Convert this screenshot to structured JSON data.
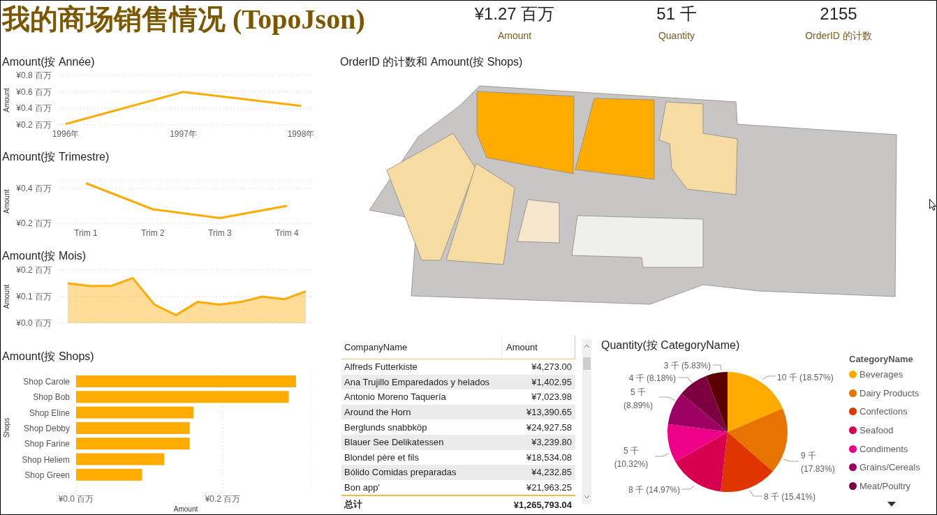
{
  "header": {
    "title": "我的商场销售情况 (TopoJson)",
    "kpis": [
      {
        "value": "¥1.27 百万",
        "label": "Amount"
      },
      {
        "value": "51 千",
        "label": "Quantity"
      },
      {
        "value": "2155",
        "label": "OrderID 的计数"
      }
    ]
  },
  "left_charts": [
    {
      "chart_data": {
        "type": "line",
        "title": "Amount(按 Année)",
        "ylabel": "Amount",
        "categories": [
          "1996年",
          "1997年",
          "1998年"
        ],
        "series": [
          {
            "color": "#ffab00",
            "values": [
              0.21,
              0.6,
              0.43
            ]
          }
        ],
        "ylim": [
          0.2,
          0.8
        ],
        "yticks": [
          {
            "value": 0.2,
            "label": "¥0.2 百万"
          },
          {
            "value": 0.4,
            "label": "¥0.4 百万"
          },
          {
            "value": 0.6,
            "label": "¥0.6 百万"
          },
          {
            "value": 0.8,
            "label": "¥0.8 百万"
          }
        ]
      }
    },
    {
      "chart_data": {
        "type": "line",
        "title": "Amount(按 Trimestre)",
        "ylabel": "Amount",
        "categories": [
          "Trim 1",
          "Trim 2",
          "Trim 3",
          "Trim 4"
        ],
        "series": [
          {
            "color": "#ffab00",
            "values": [
              0.43,
              0.28,
              0.23,
              0.3
            ]
          }
        ],
        "ylim": [
          0.2,
          0.45
        ],
        "yticks": [
          {
            "value": 0.2,
            "label": "¥0.2 百万"
          },
          {
            "value": 0.4,
            "label": "¥0.4 百万"
          }
        ]
      }
    },
    {
      "chart_data": {
        "type": "area",
        "title": "Amount(按 Mois)",
        "ylabel": "Amount",
        "series": [
          {
            "color": "#ffab00",
            "values": [
              0.15,
              0.14,
              0.14,
              0.17,
              0.07,
              0.03,
              0.08,
              0.07,
              0.08,
              0.1,
              0.09,
              0.12
            ]
          }
        ],
        "ylim": [
          0,
          0.2
        ],
        "yticks": [
          {
            "value": 0,
            "label": "¥0.0 百万"
          },
          {
            "value": 0.1,
            "label": "¥0.1 百万"
          },
          {
            "value": 0.2,
            "label": "¥0.2 百万"
          }
        ]
      }
    },
    {
      "chart_data": {
        "type": "bar",
        "orientation": "horizontal",
        "title": "Amount(按 Shops)",
        "xlabel": "Amount",
        "ylabel": "Shops",
        "categories": [
          "Shop Carole",
          "Shop Bob",
          "Shop Eline",
          "Shop Debby",
          "Shop Farine",
          "Shop Heliem",
          "Shop Green"
        ],
        "series": [
          {
            "color": "#ffab00",
            "values": [
              0.3,
              0.29,
              0.16,
              0.155,
              0.155,
              0.12,
              0.09
            ]
          }
        ],
        "xlim": [
          0,
          0.32
        ],
        "xticks": [
          {
            "value": 0,
            "label": "¥0.0 百万"
          },
          {
            "value": 0.2,
            "label": "¥0.2 百万"
          }
        ]
      }
    }
  ],
  "map": {
    "title": "OrderID 的计数和 Amount(按 Shops)"
  },
  "table": {
    "columns": [
      "CompanyName",
      "Amount"
    ],
    "rows": [
      [
        "Alfreds Futterkiste",
        "¥4,273.00"
      ],
      [
        "Ana Trujillo Emparedados y helados",
        "¥1,402.95"
      ],
      [
        "Antonio Moreno Taquería",
        "¥7,023.98"
      ],
      [
        "Around the Horn",
        "¥13,390.65"
      ],
      [
        "Berglunds snabbköp",
        "¥24,927.58"
      ],
      [
        "Blauer See Delikatessen",
        "¥3,239.80"
      ],
      [
        "Blondel père et fils",
        "¥18,534.08"
      ],
      [
        "Bólido Comidas preparadas",
        "¥4,232.85"
      ],
      [
        "Bon app'",
        "¥21,963.25"
      ]
    ],
    "total": [
      "总计",
      "¥1,265,793.04"
    ]
  },
  "pie": {
    "chart_data": {
      "type": "pie",
      "title": "Quantity(按 CategoryName)",
      "values": [
        18.57,
        17.83,
        15.41,
        14.97,
        10.32,
        8.89,
        8.18,
        5.83
      ],
      "colors": [
        "#ffab00",
        "#e87400",
        "#e03500",
        "#d6004f",
        "#ef0089",
        "#9b0062",
        "#7c0040",
        "#5a0000"
      ],
      "value_labels": [
        "10 千 (18.57%)",
        "9 千 (17.83%)",
        "8 千 (15.41%)",
        "8 千 (14.97%)",
        "5 千 (10.32%)",
        "5 千 (8.89%)",
        "4 千 (8.18%)",
        "3 千 (5.83%)"
      ]
    }
  },
  "legend": {
    "title": "CategoryName",
    "items": [
      {
        "label": "Beverages",
        "color": "#ffab00"
      },
      {
        "label": "Dairy Products",
        "color": "#e87400"
      },
      {
        "label": "Confections",
        "color": "#e03500"
      },
      {
        "label": "Seafood",
        "color": "#d6004f"
      },
      {
        "label": "Condiments",
        "color": "#ef0089"
      },
      {
        "label": "Grains/Cereals",
        "color": "#9b0062"
      },
      {
        "label": "Meat/Poultry",
        "color": "#7c0040"
      }
    ]
  }
}
